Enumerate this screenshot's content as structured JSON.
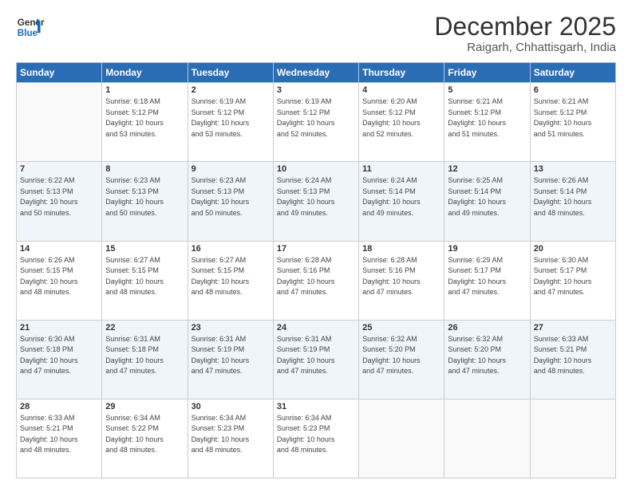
{
  "header": {
    "logo_line1": "General",
    "logo_line2": "Blue",
    "title": "December 2025",
    "subtitle": "Raigarh, Chhattisgarh, India"
  },
  "days_of_week": [
    "Sunday",
    "Monday",
    "Tuesday",
    "Wednesday",
    "Thursday",
    "Friday",
    "Saturday"
  ],
  "weeks": [
    [
      {
        "day": "",
        "info": ""
      },
      {
        "day": "1",
        "info": "Sunrise: 6:18 AM\nSunset: 5:12 PM\nDaylight: 10 hours\nand 53 minutes."
      },
      {
        "day": "2",
        "info": "Sunrise: 6:19 AM\nSunset: 5:12 PM\nDaylight: 10 hours\nand 53 minutes."
      },
      {
        "day": "3",
        "info": "Sunrise: 6:19 AM\nSunset: 5:12 PM\nDaylight: 10 hours\nand 52 minutes."
      },
      {
        "day": "4",
        "info": "Sunrise: 6:20 AM\nSunset: 5:12 PM\nDaylight: 10 hours\nand 52 minutes."
      },
      {
        "day": "5",
        "info": "Sunrise: 6:21 AM\nSunset: 5:12 PM\nDaylight: 10 hours\nand 51 minutes."
      },
      {
        "day": "6",
        "info": "Sunrise: 6:21 AM\nSunset: 5:12 PM\nDaylight: 10 hours\nand 51 minutes."
      }
    ],
    [
      {
        "day": "7",
        "info": "Sunrise: 6:22 AM\nSunset: 5:13 PM\nDaylight: 10 hours\nand 50 minutes."
      },
      {
        "day": "8",
        "info": "Sunrise: 6:23 AM\nSunset: 5:13 PM\nDaylight: 10 hours\nand 50 minutes."
      },
      {
        "day": "9",
        "info": "Sunrise: 6:23 AM\nSunset: 5:13 PM\nDaylight: 10 hours\nand 50 minutes."
      },
      {
        "day": "10",
        "info": "Sunrise: 6:24 AM\nSunset: 5:13 PM\nDaylight: 10 hours\nand 49 minutes."
      },
      {
        "day": "11",
        "info": "Sunrise: 6:24 AM\nSunset: 5:14 PM\nDaylight: 10 hours\nand 49 minutes."
      },
      {
        "day": "12",
        "info": "Sunrise: 6:25 AM\nSunset: 5:14 PM\nDaylight: 10 hours\nand 49 minutes."
      },
      {
        "day": "13",
        "info": "Sunrise: 6:26 AM\nSunset: 5:14 PM\nDaylight: 10 hours\nand 48 minutes."
      }
    ],
    [
      {
        "day": "14",
        "info": "Sunrise: 6:26 AM\nSunset: 5:15 PM\nDaylight: 10 hours\nand 48 minutes."
      },
      {
        "day": "15",
        "info": "Sunrise: 6:27 AM\nSunset: 5:15 PM\nDaylight: 10 hours\nand 48 minutes."
      },
      {
        "day": "16",
        "info": "Sunrise: 6:27 AM\nSunset: 5:15 PM\nDaylight: 10 hours\nand 48 minutes."
      },
      {
        "day": "17",
        "info": "Sunrise: 6:28 AM\nSunset: 5:16 PM\nDaylight: 10 hours\nand 47 minutes."
      },
      {
        "day": "18",
        "info": "Sunrise: 6:28 AM\nSunset: 5:16 PM\nDaylight: 10 hours\nand 47 minutes."
      },
      {
        "day": "19",
        "info": "Sunrise: 6:29 AM\nSunset: 5:17 PM\nDaylight: 10 hours\nand 47 minutes."
      },
      {
        "day": "20",
        "info": "Sunrise: 6:30 AM\nSunset: 5:17 PM\nDaylight: 10 hours\nand 47 minutes."
      }
    ],
    [
      {
        "day": "21",
        "info": "Sunrise: 6:30 AM\nSunset: 5:18 PM\nDaylight: 10 hours\nand 47 minutes."
      },
      {
        "day": "22",
        "info": "Sunrise: 6:31 AM\nSunset: 5:18 PM\nDaylight: 10 hours\nand 47 minutes."
      },
      {
        "day": "23",
        "info": "Sunrise: 6:31 AM\nSunset: 5:19 PM\nDaylight: 10 hours\nand 47 minutes."
      },
      {
        "day": "24",
        "info": "Sunrise: 6:31 AM\nSunset: 5:19 PM\nDaylight: 10 hours\nand 47 minutes."
      },
      {
        "day": "25",
        "info": "Sunrise: 6:32 AM\nSunset: 5:20 PM\nDaylight: 10 hours\nand 47 minutes."
      },
      {
        "day": "26",
        "info": "Sunrise: 6:32 AM\nSunset: 5:20 PM\nDaylight: 10 hours\nand 47 minutes."
      },
      {
        "day": "27",
        "info": "Sunrise: 6:33 AM\nSunset: 5:21 PM\nDaylight: 10 hours\nand 48 minutes."
      }
    ],
    [
      {
        "day": "28",
        "info": "Sunrise: 6:33 AM\nSunset: 5:21 PM\nDaylight: 10 hours\nand 48 minutes."
      },
      {
        "day": "29",
        "info": "Sunrise: 6:34 AM\nSunset: 5:22 PM\nDaylight: 10 hours\nand 48 minutes."
      },
      {
        "day": "30",
        "info": "Sunrise: 6:34 AM\nSunset: 5:23 PM\nDaylight: 10 hours\nand 48 minutes."
      },
      {
        "day": "31",
        "info": "Sunrise: 6:34 AM\nSunset: 5:23 PM\nDaylight: 10 hours\nand 48 minutes."
      },
      {
        "day": "",
        "info": ""
      },
      {
        "day": "",
        "info": ""
      },
      {
        "day": "",
        "info": ""
      }
    ]
  ]
}
